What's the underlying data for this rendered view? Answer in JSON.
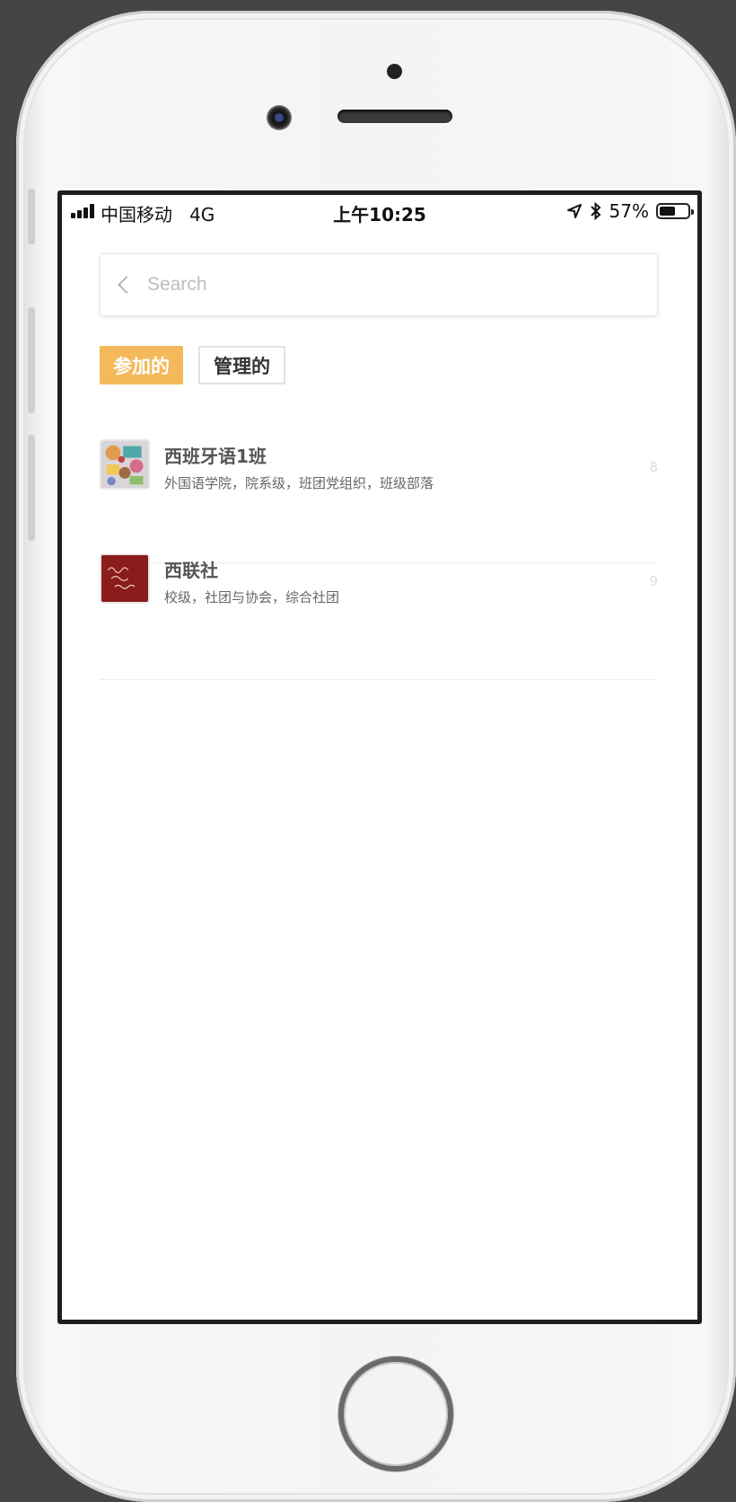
{
  "status_bar": {
    "carrier": "中国移动",
    "network": "4G",
    "time": "上午10:25",
    "battery": "57%",
    "battery_level": 0.57
  },
  "search": {
    "placeholder": "Search"
  },
  "tabs": [
    {
      "label": "参加的",
      "active": true
    },
    {
      "label": "管理的",
      "active": false
    }
  ],
  "groups": [
    {
      "name": "西班牙语1班",
      "tags": "外国语学院，院系级，班团党组织，班级部落",
      "count": "8",
      "avatar_icon": "collage-photo-icon"
    },
    {
      "name": "西联社",
      "tags": "校级，社团与协会，综合社团",
      "count": "9",
      "avatar_icon": "red-handwriting-icon"
    }
  ],
  "colors": {
    "accent": "#f3b95c",
    "avatar_red": "#8a1c1c"
  }
}
